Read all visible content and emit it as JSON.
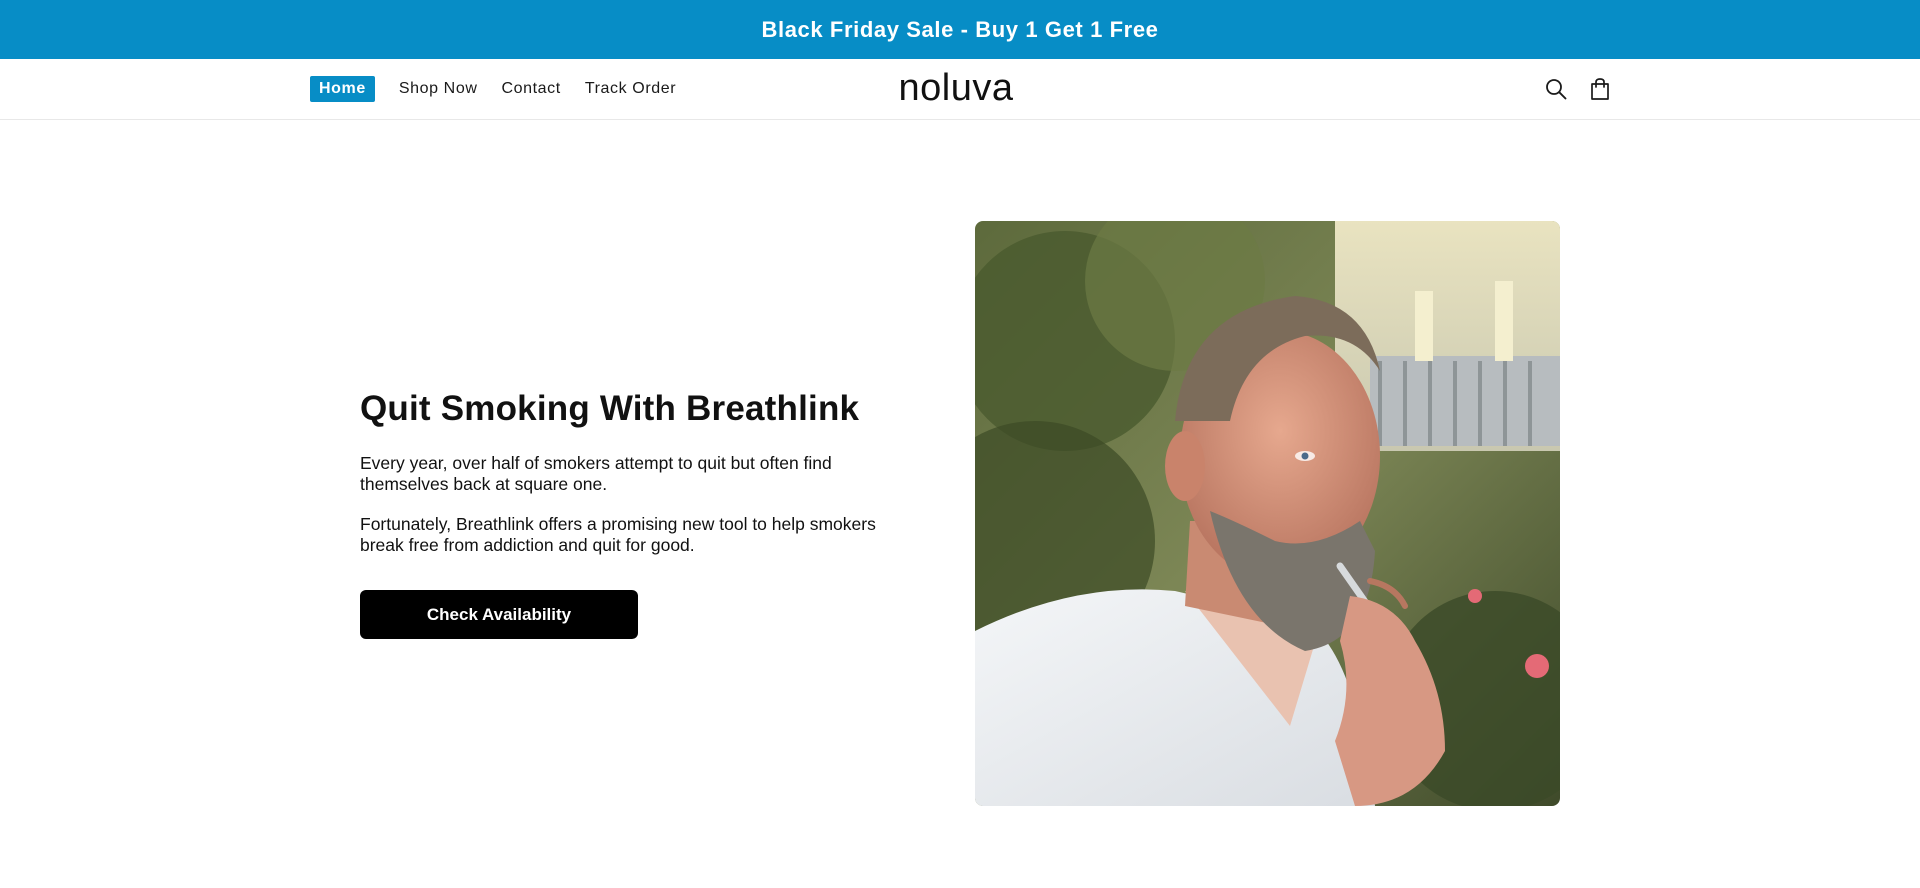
{
  "announcement": {
    "text": "Black Friday Sale - Buy 1 Get 1 Free"
  },
  "header": {
    "logo": "noluva",
    "nav": [
      {
        "label": "Home",
        "active": true
      },
      {
        "label": "Shop Now",
        "active": false
      },
      {
        "label": "Contact",
        "active": false
      },
      {
        "label": "Track Order",
        "active": false
      }
    ],
    "icons": [
      "search-icon",
      "cart-icon"
    ]
  },
  "hero": {
    "title": "Quit Smoking With Breathlink",
    "paragraphs": [
      "Every year, over half of smokers attempt to quit but often find themselves back at square one.",
      "Fortunately, Breathlink offers a promising new tool to help smokers break free from addiction and quit for good."
    ],
    "cta_label": "Check Availability"
  },
  "colors": {
    "accent": "#078dc6",
    "button": "#000000",
    "text": "#111111"
  }
}
